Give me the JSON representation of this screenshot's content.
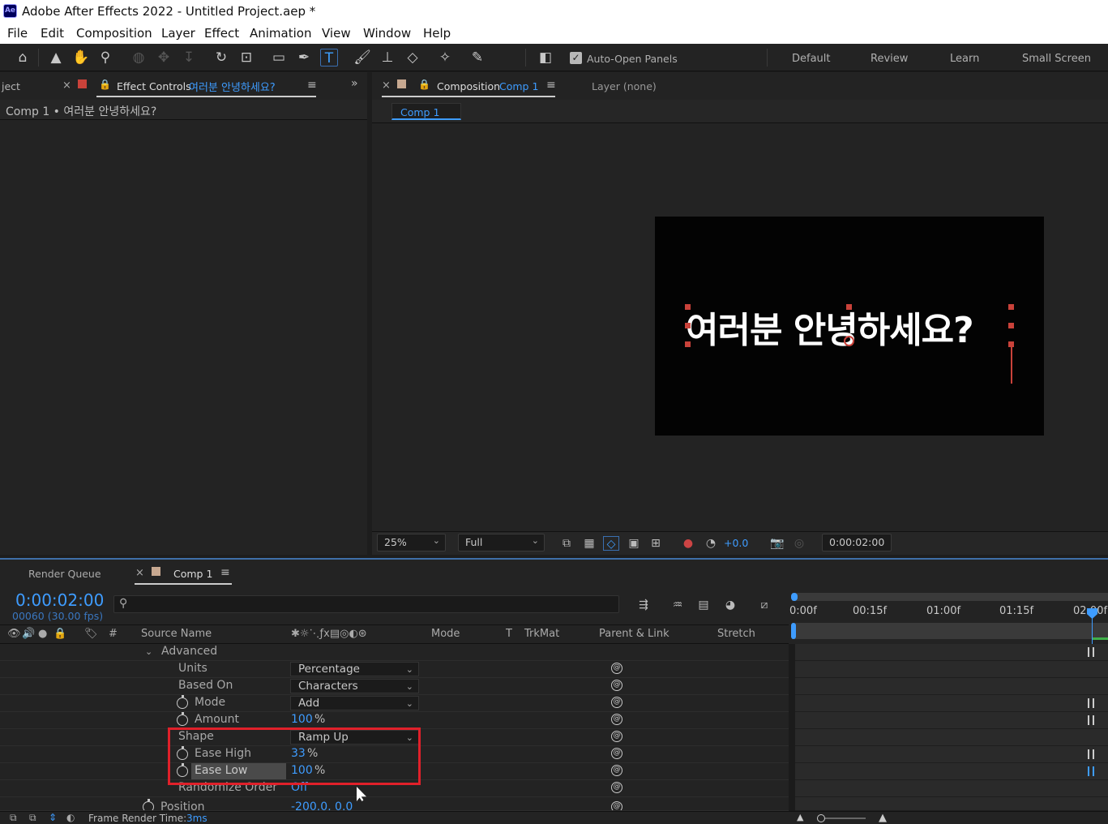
{
  "app": {
    "logo": "Ae",
    "title": "Adobe After Effects 2022 - Untitled Project.aep *"
  },
  "menu": [
    "File",
    "Edit",
    "Composition",
    "Layer",
    "Effect",
    "Animation",
    "View",
    "Window",
    "Help"
  ],
  "toolbar": {
    "auto_open_label": "Auto-Open Panels",
    "auto_open_checked": true,
    "workspaces": [
      "Default",
      "Review",
      "Learn",
      "Small Screen"
    ]
  },
  "left_panel": {
    "project_tab_fragment": "ject",
    "effect_tab_label": "Effect Controls",
    "effect_tab_layer": "여러분 안녕하세요?",
    "subheader": "Comp 1 • 여러분 안녕하세요?",
    "tab_color": "#c9423a"
  },
  "comp_panel": {
    "tab_label": "Composition",
    "tab_comp": "Comp 1",
    "layer_tab": "Layer (none)",
    "flow_chip": "Comp 1",
    "tab_color": "#c7a890",
    "canvas_text": "여러분 안녕하세요?",
    "zoom": "25%",
    "resolution": "Full",
    "exposure": "+0.0",
    "timecode": "0:00:02:00"
  },
  "timeline": {
    "render_queue_tab": "Render Queue",
    "comp_tab": "Comp 1",
    "tab_color": "#c7a890",
    "current_time": "0:00:02:00",
    "frame_info": "00060 (30.00 fps)",
    "search_placeholder": "",
    "columns": {
      "number": "#",
      "source_name": "Source Name",
      "mode": "Mode",
      "t": "T",
      "trkmat": "TrkMat",
      "parent": "Parent & Link",
      "stretch": "Stretch"
    },
    "ruler": [
      "0:00f",
      "00:15f",
      "01:00f",
      "01:15f",
      "02:00f"
    ],
    "rows": [
      {
        "label": "Advanced",
        "type": "group"
      },
      {
        "label": "Units",
        "type": "dropdown",
        "value": "Percentage"
      },
      {
        "label": "Based On",
        "type": "dropdown",
        "value": "Characters"
      },
      {
        "label": "Mode",
        "type": "dropdown",
        "value": "Add",
        "stopwatch": true
      },
      {
        "label": "Amount",
        "type": "value",
        "value": "100",
        "unit": "%",
        "stopwatch": true
      },
      {
        "label": "Shape",
        "type": "dropdown",
        "value": "Ramp Up"
      },
      {
        "label": "Ease High",
        "type": "value",
        "value": "33",
        "unit": "%",
        "stopwatch": true
      },
      {
        "label": "Ease Low",
        "type": "value",
        "value": "100",
        "unit": "%",
        "stopwatch": true,
        "selected": true
      },
      {
        "label": "Randomize Order",
        "type": "value",
        "value": "Off"
      },
      {
        "label": "Position",
        "type": "value",
        "value": "-200.0, 0.0",
        "stopwatch": true
      }
    ],
    "status": {
      "label": "Frame Render Time:",
      "value": "3ms"
    }
  },
  "colors": {
    "accent": "#3e9cff",
    "highlight_box": "#e0202a",
    "canvas_bg": "#030303"
  }
}
